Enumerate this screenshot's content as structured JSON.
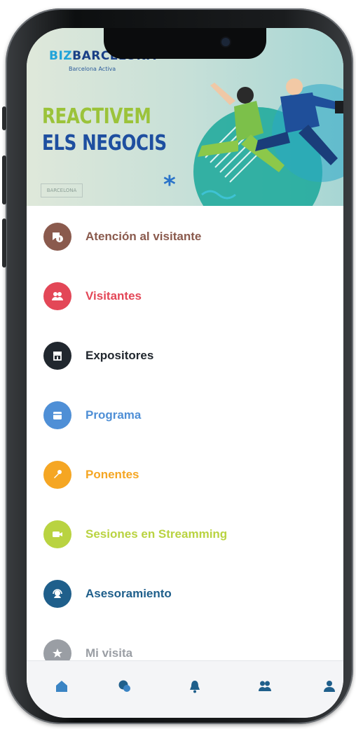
{
  "banner": {
    "brand_biz": "BIZ",
    "brand_rest": "BARCELONA",
    "brand_sub": "Barcelona Activa",
    "headline_line1": "REACTIVEM",
    "headline_line2": "ELS NEGOCIS",
    "small_logo": "BARCELONA"
  },
  "menu": {
    "items": [
      {
        "label": "Atención al visitante",
        "icon": "info-chat-icon",
        "color": "#8a5a4d"
      },
      {
        "label": "Visitantes",
        "icon": "people-icon",
        "color": "#e34757"
      },
      {
        "label": "Expositores",
        "icon": "store-icon",
        "color": "#21272e"
      },
      {
        "label": "Programa",
        "icon": "calendar-icon",
        "color": "#4f8fd6"
      },
      {
        "label": "Ponentes",
        "icon": "microphone-icon",
        "color": "#f5a623"
      },
      {
        "label": "Sesiones en Streamming",
        "icon": "video-camera-icon",
        "color": "#b9d341"
      },
      {
        "label": "Asesoramiento",
        "icon": "support-agent-icon",
        "color": "#1f5f8b"
      },
      {
        "label": "Mi visita",
        "icon": "star-icon",
        "color": "#9a9ea4"
      }
    ]
  },
  "tabbar": {
    "items": [
      {
        "icon": "home-icon",
        "color": "#3a84c4"
      },
      {
        "icon": "chat-icon",
        "color": "#1f5f8b"
      },
      {
        "icon": "bell-icon",
        "color": "#1f5f8b"
      },
      {
        "icon": "group-icon",
        "color": "#1f5f8b"
      },
      {
        "icon": "user-icon",
        "color": "#1f5f8b"
      }
    ]
  }
}
